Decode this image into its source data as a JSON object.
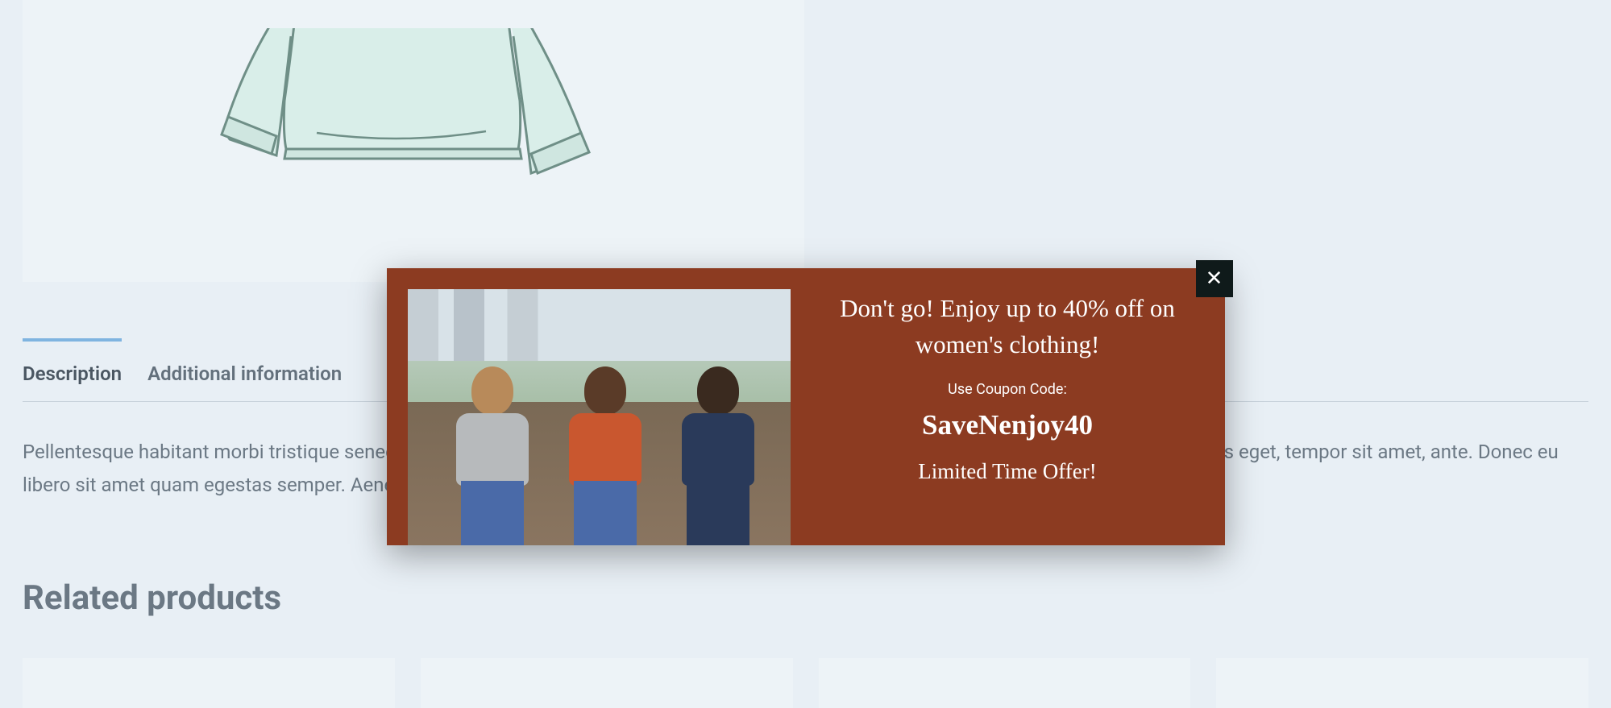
{
  "tabs": {
    "description": "Description",
    "additional": "Additional information"
  },
  "description_body": "Pellentesque habitant morbi tristique senectus et netus et malesuada fames ac turpis egestas. Vestibulum tortor quam, feugiat vitae, ultricies eget, tempor sit amet, ante. Donec eu libero sit amet quam egestas semper. Aenean ultricies mi vitae est. Mauris placerat eleifend leo.",
  "related_heading": "Related products",
  "modal": {
    "headline": "Don't go! Enjoy up to 40% off on women's clothing!",
    "sub": "Use Coupon Code:",
    "code": "SaveNenjoy40",
    "limited": "Limited Time Offer!",
    "close": "✕"
  }
}
